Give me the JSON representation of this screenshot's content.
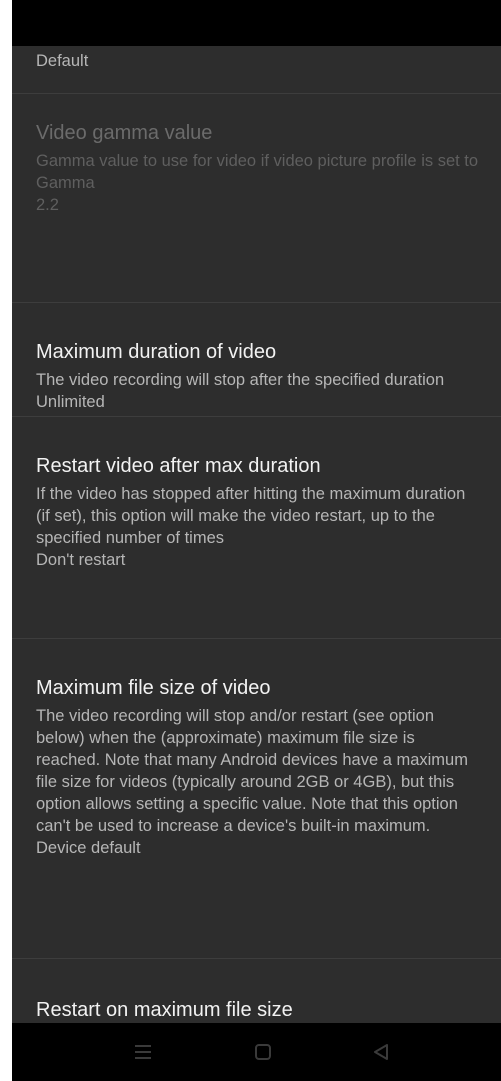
{
  "settings": {
    "items": [
      {
        "title": "",
        "summary": "",
        "value": "Default"
      },
      {
        "title": "Video gamma value",
        "summary": "Gamma value to use for video if video picture profile is set to Gamma",
        "value": "2.2"
      },
      {
        "title": "Maximum duration of video",
        "summary": "The video recording will stop after the specified duration",
        "value": "Unlimited"
      },
      {
        "title": "Restart video after max duration",
        "summary": "If the video has stopped after hitting the maximum duration (if set), this option will make the video restart, up to the specified number of times",
        "value": "Don't restart"
      },
      {
        "title": "Maximum file size of video",
        "summary": "The video recording will stop and/or restart (see option below) when the (approximate) maximum file size is reached. Note that many Android devices have a maximum file size for videos (typically around 2GB or 4GB), but this option allows setting a specific value. Note that this option can't be used to increase a device's built-in maximum.",
        "value": "Device default"
      },
      {
        "title": "Restart on maximum file size",
        "summary": "",
        "value": ""
      }
    ]
  },
  "navigation": {
    "icons": [
      "menu-icon",
      "home-icon",
      "back-icon"
    ]
  },
  "colors": {
    "background": "#2d2d2d",
    "title_text": "#f2f2f2",
    "summary_text": "#b6b6b6",
    "disabled_text": "#5f5f5f",
    "bars": "#000000"
  }
}
